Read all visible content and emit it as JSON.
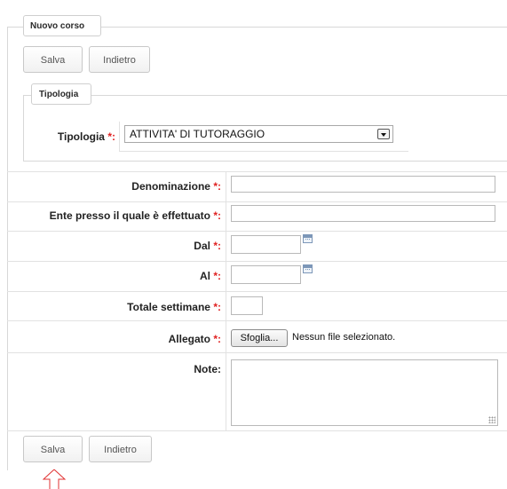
{
  "form": {
    "legend": "Nuovo corso",
    "top_buttons": {
      "save": "Salva",
      "back": "Indietro"
    },
    "bottom_buttons": {
      "save": "Salva",
      "back": "Indietro"
    },
    "required_marker": "*:",
    "tipologia_section": {
      "legend": "Tipologia",
      "label": "Tipologia",
      "selected": "ATTIVITA' DI TUTORAGGIO"
    },
    "fields": {
      "denominazione": {
        "label": "Denominazione",
        "value": ""
      },
      "ente": {
        "label": "Ente presso il quale è effettuato",
        "value": ""
      },
      "dal": {
        "label": "Dal",
        "value": ""
      },
      "al": {
        "label": "Al",
        "value": ""
      },
      "settimane": {
        "label": "Totale settimane",
        "value": ""
      },
      "allegato": {
        "label": "Allegato",
        "button": "Sfoglia...",
        "status": "Nessun file selezionato."
      },
      "note": {
        "label": "Note:",
        "value": ""
      }
    }
  },
  "colors": {
    "required": "#e02020",
    "border": "#d8d8d8",
    "text": "#222222"
  },
  "icons": {
    "calendar": "calendar-icon",
    "pointer": "arrow-up-icon"
  }
}
